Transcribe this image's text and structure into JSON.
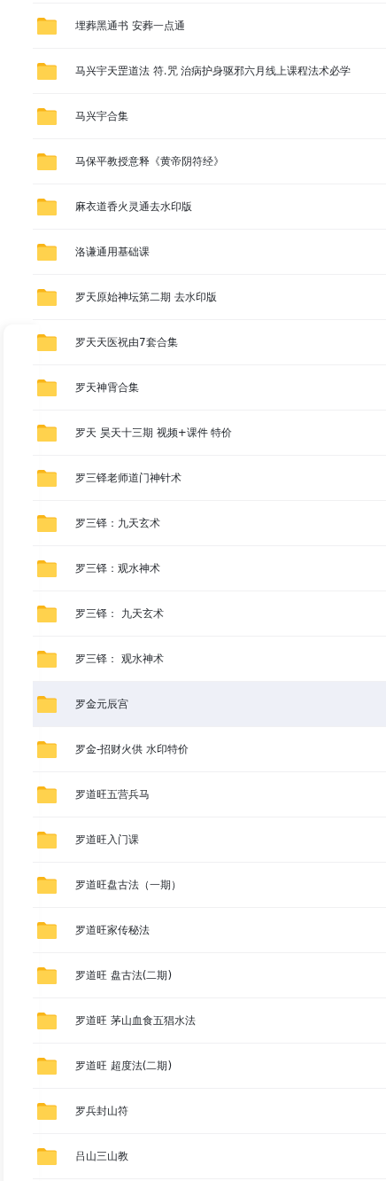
{
  "folders": [
    {
      "name": "埋葬黑通书 安葬一点通",
      "selected": false
    },
    {
      "name": "马兴宇天罡道法 符.咒 治病护身驱邪六月线上课程法术必学",
      "selected": false
    },
    {
      "name": "马兴宇合集",
      "selected": false
    },
    {
      "name": "马保平教授意释《黄帝阴符经》",
      "selected": false
    },
    {
      "name": "麻衣道香火灵通去水印版",
      "selected": false
    },
    {
      "name": "洛谦通用基础课",
      "selected": false
    },
    {
      "name": "罗天原始神坛第二期 去水印版",
      "selected": false
    },
    {
      "name": "罗天天医祝由7套合集",
      "selected": false
    },
    {
      "name": "罗天神霄合集",
      "selected": false
    },
    {
      "name": "罗天 昊天十三期 视频+课件 特价",
      "selected": false
    },
    {
      "name": "罗三铎老师道门神针术",
      "selected": false
    },
    {
      "name": "罗三铎：九天玄术",
      "selected": false
    },
    {
      "name": "罗三铎：观水神术",
      "selected": false
    },
    {
      "name": "罗三铎： 九天玄术",
      "selected": false
    },
    {
      "name": "罗三铎： 观水神术",
      "selected": false
    },
    {
      "name": "罗金元辰宫",
      "selected": true
    },
    {
      "name": "罗金-招财火供 水印特价",
      "selected": false
    },
    {
      "name": "罗道旺五营兵马",
      "selected": false
    },
    {
      "name": "罗道旺入门课",
      "selected": false
    },
    {
      "name": "罗道旺盘古法（一期）",
      "selected": false
    },
    {
      "name": "罗道旺家传秘法",
      "selected": false
    },
    {
      "name": "罗道旺 盘古法(二期)",
      "selected": false
    },
    {
      "name": "罗道旺 茅山血食五猖水法",
      "selected": false
    },
    {
      "name": "罗道旺 超度法(二期)",
      "selected": false
    },
    {
      "name": "罗兵封山符",
      "selected": false
    },
    {
      "name": "吕山三山教",
      "selected": false
    }
  ]
}
